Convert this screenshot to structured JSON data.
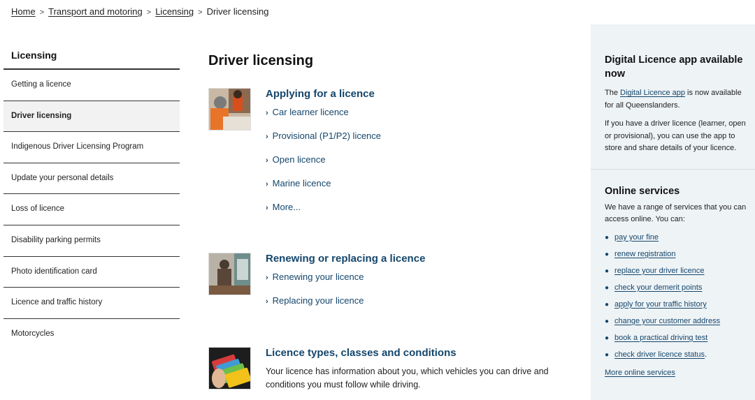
{
  "breadcrumb": {
    "items": [
      "Home",
      "Transport and motoring",
      "Licensing"
    ],
    "current": "Driver licensing"
  },
  "sidenav": {
    "title": "Licensing",
    "items": [
      "Getting a licence",
      "Driver licensing",
      "Indigenous Driver Licensing Program",
      "Update your personal details",
      "Loss of licence",
      "Disability parking permits",
      "Photo identification card",
      "Licence and traffic history",
      "Motorcycles"
    ],
    "active_index": 1
  },
  "main": {
    "title": "Driver licensing",
    "sections": [
      {
        "title": "Applying for a licence",
        "links": [
          "Car learner licence",
          "Provisional (P1/P2) licence",
          "Open licence",
          "Marine licence",
          "More..."
        ]
      },
      {
        "title": "Renewing or replacing a licence",
        "links": [
          "Renewing your licence",
          "Replacing your licence"
        ]
      },
      {
        "title": "Licence types, classes and conditions",
        "description": "Your licence has information about you, which vehicles you can drive and conditions you must follow while driving."
      }
    ],
    "chevron": "›"
  },
  "aside": {
    "app": {
      "title": "Digital Licence app available now",
      "p1_prefix": "The",
      "p1_link": "Digital Licence app",
      "p1_suffix": "is now available for all Queenslanders.",
      "p2": "If you have a driver licence (learner, open or provisional), you can use the app to store and share details of your licence."
    },
    "online": {
      "title": "Online services",
      "intro": "We have a range of services that you can access online. You can:",
      "services": [
        "pay your fine",
        "renew registration",
        "replace your driver licence",
        "check your demerit points",
        "apply for your traffic history",
        "change your customer address",
        "book a practical driving test",
        "check driver licence status"
      ],
      "last_suffix": ".",
      "more_link": "More online services"
    }
  },
  "colors": {
    "link": "#14466b",
    "aside_bg": "#eef3f6",
    "active_nav_bg": "#f2f2f2"
  }
}
